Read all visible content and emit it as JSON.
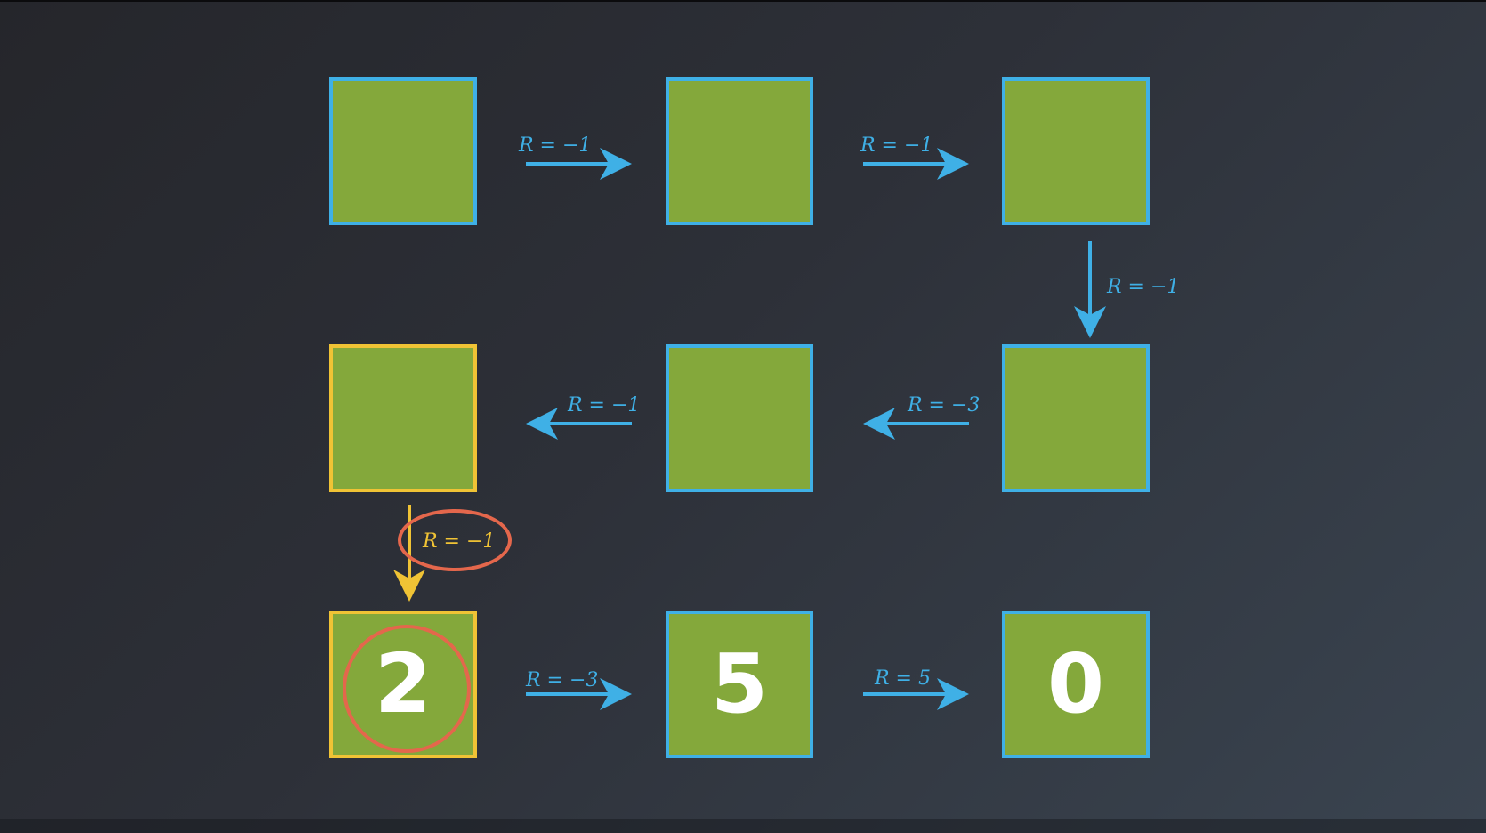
{
  "colors": {
    "cell_fill": "#84a83b",
    "cell_border": "#3fb0e6",
    "highlight": "#f0c335",
    "annotation": "#e4674c",
    "value_text": "#ffffff"
  },
  "grid": {
    "cells": [
      {
        "id": "r1c1",
        "value": "",
        "highlighted": false
      },
      {
        "id": "r1c2",
        "value": "",
        "highlighted": false
      },
      {
        "id": "r1c3",
        "value": "",
        "highlighted": false
      },
      {
        "id": "r2c1",
        "value": "",
        "highlighted": true
      },
      {
        "id": "r2c2",
        "value": "",
        "highlighted": false
      },
      {
        "id": "r2c3",
        "value": "",
        "highlighted": false
      },
      {
        "id": "r3c1",
        "value": "2",
        "highlighted": true
      },
      {
        "id": "r3c2",
        "value": "5",
        "highlighted": false
      },
      {
        "id": "r3c3",
        "value": "0",
        "highlighted": false
      }
    ]
  },
  "transitions": [
    {
      "from": "r1c1",
      "to": "r1c2",
      "label": "R = −1",
      "highlighted": false
    },
    {
      "from": "r1c2",
      "to": "r1c3",
      "label": "R = −1",
      "highlighted": false
    },
    {
      "from": "r1c3",
      "to": "r2c3",
      "label": "R = −1",
      "highlighted": false
    },
    {
      "from": "r2c2",
      "to": "r2c1",
      "label": "R = −1",
      "highlighted": false
    },
    {
      "from": "r2c3",
      "to": "r2c2",
      "label": "R = −3",
      "highlighted": false
    },
    {
      "from": "r2c1",
      "to": "r3c1",
      "label": "R = −1",
      "highlighted": true
    },
    {
      "from": "r3c1",
      "to": "r3c2",
      "label": "R = −3",
      "highlighted": false
    },
    {
      "from": "r3c2",
      "to": "r3c3",
      "label": "R = 5",
      "highlighted": false
    }
  ],
  "annotations": [
    {
      "target": "transition r2c1 to r3c1 label",
      "shape": "ellipse"
    },
    {
      "target": "cell r3c1 value",
      "shape": "circle"
    }
  ]
}
